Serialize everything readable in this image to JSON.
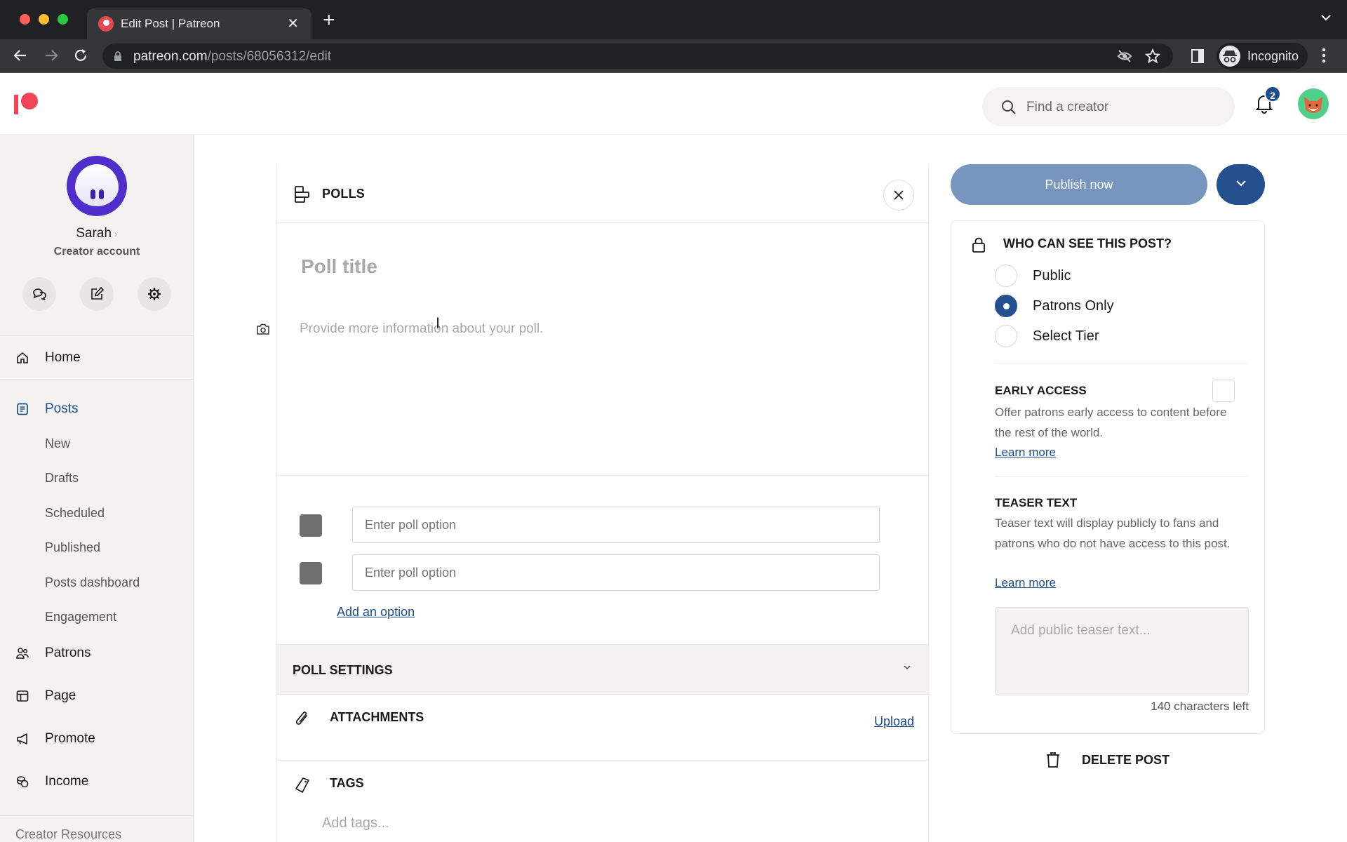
{
  "browser": {
    "tab_title": "Edit Post | Patreon",
    "url_domain": "patreon.com",
    "url_path": "/posts/68056312/edit",
    "profile_label": "Incognito",
    "traffic_colors": {
      "close": "#ff5f57",
      "minimize": "#febc2e",
      "maximize": "#28c840"
    }
  },
  "header": {
    "brand_color": "#f1465a",
    "search_placeholder": "Find a creator",
    "notifications_count": "2"
  },
  "sidebar": {
    "creator_name": "Sarah",
    "account_type": "Creator account",
    "quick_actions": [
      "chat-icon",
      "edit-icon",
      "gear-icon"
    ],
    "nav": [
      {
        "label": "Home",
        "icon": "home-icon"
      },
      {
        "label": "Posts",
        "icon": "posts-icon",
        "active": true
      },
      {
        "label": "Patrons",
        "icon": "patrons-icon"
      },
      {
        "label": "Page",
        "icon": "page-icon"
      },
      {
        "label": "Promote",
        "icon": "megaphone-icon"
      },
      {
        "label": "Income",
        "icon": "coins-icon"
      }
    ],
    "posts_sub": [
      "New",
      "Drafts",
      "Scheduled",
      "Published",
      "Posts dashboard",
      "Engagement"
    ],
    "footer_label": "Creator Resources"
  },
  "editor": {
    "section_label": "POLLS",
    "poll_title_placeholder": "Poll title",
    "poll_desc_placeholder": "Provide more information about your poll.",
    "options": [
      {
        "placeholder": "Enter poll option",
        "value": ""
      },
      {
        "placeholder": "Enter poll option",
        "value": ""
      }
    ],
    "add_option_label": "Add an option",
    "poll_settings_label": "POLL SETTINGS",
    "attachments_label": "ATTACHMENTS",
    "upload_label": "Upload",
    "tags_label": "TAGS",
    "tags_placeholder": "Add tags..."
  },
  "publish": {
    "publish_label": "Publish now",
    "accent_color": "#25508e"
  },
  "visibility": {
    "title": "WHO CAN SEE THIS POST?",
    "options": [
      {
        "label": "Public",
        "selected": false
      },
      {
        "label": "Patrons Only",
        "selected": true
      },
      {
        "label": "Select Tier",
        "selected": false
      }
    ]
  },
  "early_access": {
    "title": "EARLY ACCESS",
    "description": "Offer patrons early access to content before the rest of the world.",
    "learn_more": "Learn more",
    "checked": false
  },
  "teaser": {
    "title": "TEASER TEXT",
    "description": "Teaser text will display publicly to fans and patrons who do not have access to this post.",
    "learn_more": "Learn more",
    "placeholder": "Add public teaser text...",
    "chars_left": "140 characters left"
  },
  "delete_label": "DELETE POST"
}
